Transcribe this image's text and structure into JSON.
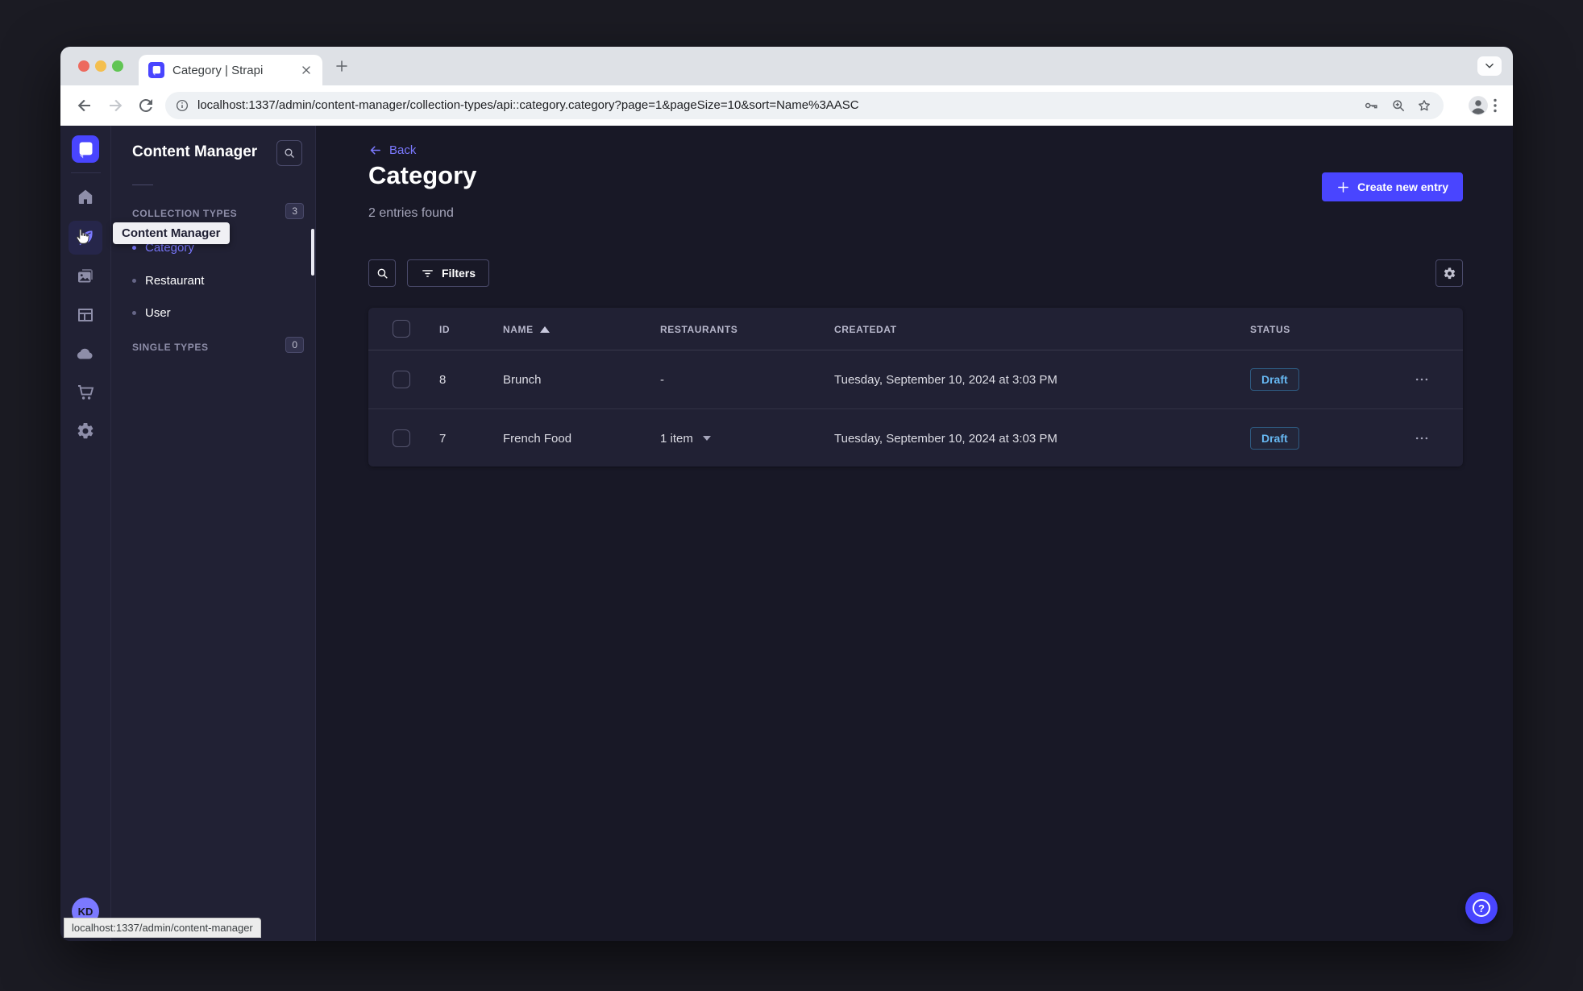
{
  "browser": {
    "tab_title": "Category | Strapi",
    "url": "localhost:1337/admin/content-manager/collection-types/api::category.category?page=1&pageSize=10&sort=Name%3AASC"
  },
  "rail": {
    "avatar_initials": "KD",
    "icons": [
      "home",
      "content-manager",
      "media-library",
      "content-type-builder",
      "cloud",
      "marketplace",
      "settings"
    ]
  },
  "nav": {
    "title": "Content Manager",
    "collection_types_label": "COLLECTION TYPES",
    "collection_types_count": "3",
    "items": [
      {
        "label": "Category",
        "active": true
      },
      {
        "label": "Restaurant",
        "active": false
      },
      {
        "label": "User",
        "active": false
      }
    ],
    "single_types_label": "SINGLE TYPES",
    "single_types_count": "0",
    "tooltip": "Content Manager"
  },
  "main": {
    "back_label": "Back",
    "title": "Category",
    "subtitle": "2 entries found",
    "create_button_label": "Create new entry",
    "filters_button_label": "Filters"
  },
  "table": {
    "headers": {
      "id": "ID",
      "name": "NAME",
      "restaurants": "RESTAURANTS",
      "createdat": "CREATEDAT",
      "status": "STATUS"
    },
    "sort": {
      "column": "NAME",
      "order": "ascending"
    },
    "rows": [
      {
        "id": "8",
        "name": "Brunch",
        "restaurants": "-",
        "createdat": "Tuesday, September 10, 2024 at 3:03 PM",
        "status": "Draft"
      },
      {
        "id": "7",
        "name": "French Food",
        "restaurants": "1 item",
        "createdat": "Tuesday, September 10, 2024 at 3:03 PM",
        "status": "Draft"
      }
    ]
  },
  "help_label": "?",
  "status_bubble": "localhost:1337/admin/content-manager",
  "colors": {
    "brand": "#4945ff",
    "brand_light": "#7b79ff",
    "app_bg": "#181826",
    "panel_bg": "#212134",
    "draft_status": "#66b7f1",
    "muted_text": "#a5a5ba"
  }
}
